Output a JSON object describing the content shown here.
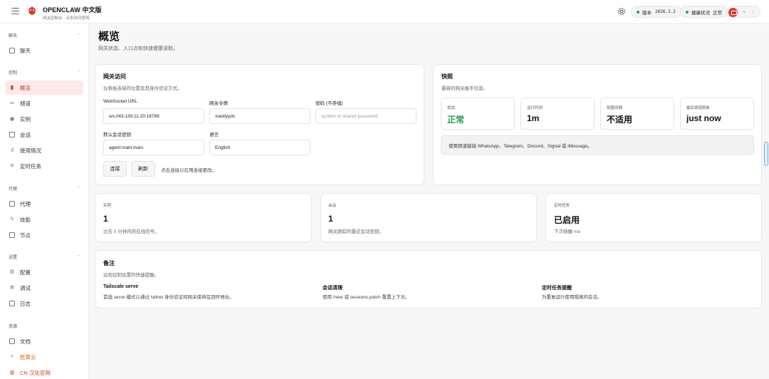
{
  "brand": {
    "title": "OPENCLAW 中文版",
    "subtitle": "网关控制台 · 点击访问官网"
  },
  "topbar": {
    "version_label": "版本",
    "version_value": "2026.3.2",
    "health_label": "健康状况",
    "health_value": "正常",
    "theme_icons": [
      "monitor-icon",
      "sun-icon",
      "moon-icon"
    ]
  },
  "colors": {
    "accent": "#d93a2b",
    "ok": "#22a35a"
  },
  "sidebar": {
    "groups": [
      {
        "label": "聊天",
        "items": [
          {
            "label": "聊天",
            "icon": "chat-icon"
          }
        ]
      },
      {
        "label": "控制",
        "items": [
          {
            "label": "概览",
            "icon": "bar-chart-icon",
            "active": true
          },
          {
            "label": "频道",
            "icon": "link-icon"
          },
          {
            "label": "实例",
            "icon": "radio-icon"
          },
          {
            "label": "会话",
            "icon": "file-icon"
          },
          {
            "label": "使用情况",
            "icon": "chart-icon"
          },
          {
            "label": "定时任务",
            "icon": "loader-icon"
          }
        ]
      },
      {
        "label": "代理",
        "items": [
          {
            "label": "代理",
            "icon": "folder-icon"
          },
          {
            "label": "技能",
            "icon": "zap-icon"
          },
          {
            "label": "节点",
            "icon": "monitor-icon"
          }
        ]
      },
      {
        "label": "设置",
        "items": [
          {
            "label": "配置",
            "icon": "settings-icon"
          },
          {
            "label": "调试",
            "icon": "bug-icon"
          },
          {
            "label": "日志",
            "icon": "log-icon"
          }
        ]
      },
      {
        "label": "资源",
        "items": [
          {
            "label": "文档",
            "icon": "book-icon"
          },
          {
            "label": "胜算云",
            "icon": "bolt-icon"
          },
          {
            "label": "CN 汉化官网",
            "icon": "globe-icon"
          }
        ]
      }
    ]
  },
  "page": {
    "title": "概览",
    "subtitle": "网关状态、入口点和快速健康读取。"
  },
  "gateway": {
    "title": "网关访问",
    "subtitle": "仪表板连接的位置及其身份验证方式。",
    "ws_label": "WebSocket URL",
    "ws_value": "ws://43.139.11.20:18789",
    "token_label": "网关令牌",
    "token_value": "xiaoliyyds",
    "password_label": "密码 (不存储)",
    "password_placeholder": "system or shared password",
    "session_label": "默认会话密钥",
    "session_value": "agent:main:main",
    "lang_label": "语言",
    "lang_value": "English",
    "connect_label": "连接",
    "refresh_label": "刷新",
    "hint": "点击连接以应用连接更改。"
  },
  "snapshot": {
    "title": "快照",
    "subtitle": "最新的网关握手信息。",
    "stats": [
      {
        "label": "状态",
        "value": "正常"
      },
      {
        "label": "运行时间",
        "value": "1m"
      },
      {
        "label": "刻度间隔",
        "value": "不适用"
      },
      {
        "label": "最后频道刷新",
        "value": "just now"
      }
    ],
    "note": "使用频道链接 WhatsApp、Telegram、Discord、Signal 或 iMessage。"
  },
  "metrics": [
    {
      "label": "实例",
      "value": "1",
      "desc": "过去 5 分钟内的在线信号。"
    },
    {
      "label": "会话",
      "value": "1",
      "desc": "网关跟踪的最近会话密钥。"
    },
    {
      "label": "定时任务",
      "value": "已启用",
      "desc": "下次唤醒 n/a"
    }
  ],
  "notes": {
    "title": "备注",
    "subtitle": "远程控制设置的快速提醒。",
    "items": [
      {
        "title": "Tailscale serve",
        "desc": "首选 serve 模式以通过 tailnet 身份验证将网关保持在回环地址。"
      },
      {
        "title": "会话清理",
        "desc": "使用 /new 或 sessions.patch 重置上下文。"
      },
      {
        "title": "定时任务提醒",
        "desc": "为重复运行使用隔离的会话。"
      }
    ]
  }
}
